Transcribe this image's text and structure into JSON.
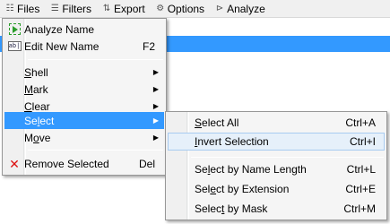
{
  "menubar": {
    "items": [
      {
        "label": "Files",
        "icon": "files-icon",
        "glyph": "☷"
      },
      {
        "label": "Filters",
        "icon": "filters-icon",
        "glyph": "☰"
      },
      {
        "label": "Export",
        "icon": "export-icon",
        "glyph": "⇅"
      },
      {
        "label": "Options",
        "icon": "options-icon",
        "glyph": "⚙"
      },
      {
        "label": "Analyze",
        "icon": "analyze-icon",
        "glyph": "⊳"
      }
    ]
  },
  "main_menu": {
    "analyze_name": {
      "label": "Analyze Name",
      "icon": "analyze-name-icon"
    },
    "edit_new_name": {
      "label": "Edit New Name",
      "shortcut": "F2",
      "icon": "edit-name-icon",
      "icon_text": "ab|"
    },
    "shell": {
      "pre": "",
      "mnemonic": "S",
      "post": "hell"
    },
    "mark": {
      "pre": "",
      "mnemonic": "M",
      "post": "ark"
    },
    "clear": {
      "pre": "",
      "mnemonic": "C",
      "post": "lear"
    },
    "select": {
      "pre": "Se",
      "mnemonic": "l",
      "post": "ect"
    },
    "move": {
      "pre": "M",
      "mnemonic": "o",
      "post": "ve"
    },
    "remove_selected": {
      "label": "Remove Selected",
      "shortcut": "Del",
      "icon": "remove-icon",
      "glyph": "✕"
    },
    "arrow": "▶"
  },
  "select_submenu": {
    "select_all": {
      "pre": "",
      "mnemonic": "S",
      "post": "elect All",
      "shortcut": "Ctrl+A"
    },
    "invert_selection": {
      "pre": "",
      "mnemonic": "I",
      "post": "nvert Selection",
      "shortcut": "Ctrl+I"
    },
    "by_name_length": {
      "pre": "Se",
      "mnemonic": "l",
      "post": "ect by Name Length",
      "shortcut": "Ctrl+L"
    },
    "by_extension": {
      "pre": "Sel",
      "mnemonic": "e",
      "post": "ct by Extension",
      "shortcut": "Ctrl+E"
    },
    "by_mask": {
      "pre": "Selec",
      "mnemonic": "t",
      "post": " by Mask",
      "shortcut": "Ctrl+M"
    }
  },
  "colors": {
    "highlight": "#3399ff",
    "menu_bg": "#f5f5f5",
    "hover_soft": "#e6f0fa",
    "remove_icon": "#dd1111",
    "run_icon": "#2a9c2a"
  }
}
